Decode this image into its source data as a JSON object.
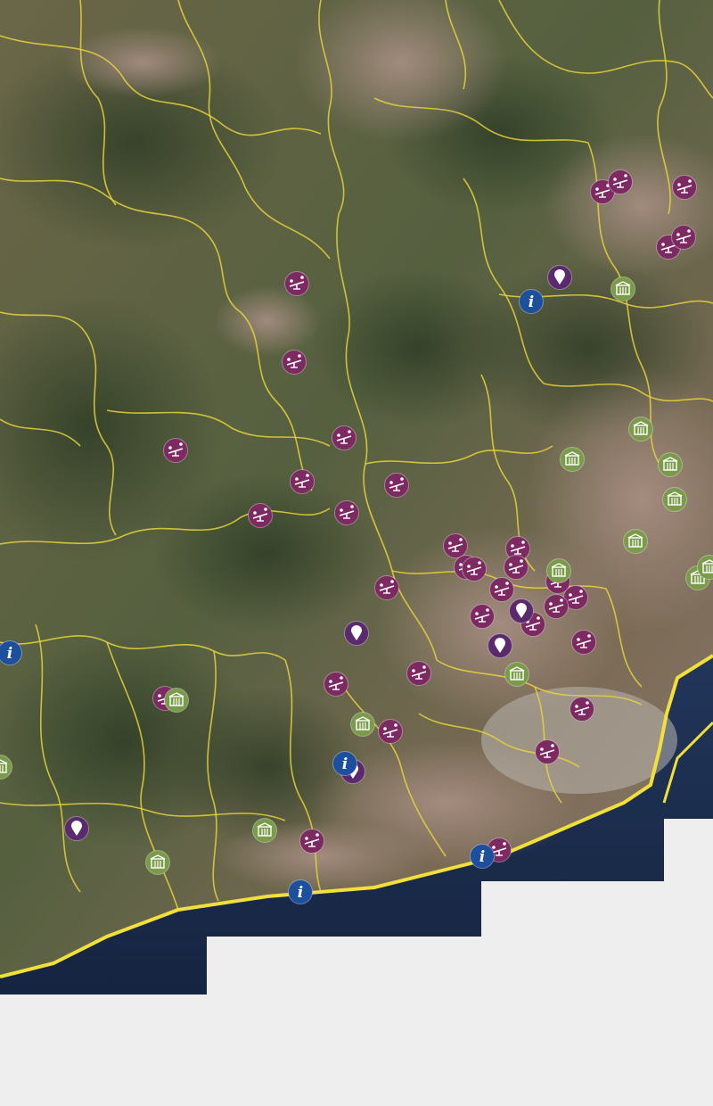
{
  "map": {
    "colors": {
      "background": "#eeeeee",
      "sea": "#1c2b4a",
      "land": "#5f6242",
      "boundary": "#e8d23a",
      "coastline": "#f2e03a",
      "playground": "#7d2a63",
      "location": "#5b2a6e",
      "info": "#1c4f9c",
      "building": "#7a9b4a"
    },
    "marker_types": {
      "playground": {
        "icon": "seesaw-icon"
      },
      "location": {
        "icon": "map-pin-icon"
      },
      "info": {
        "icon": "info-icon",
        "glyph": "i"
      },
      "building": {
        "icon": "building-icon"
      }
    }
  }
}
